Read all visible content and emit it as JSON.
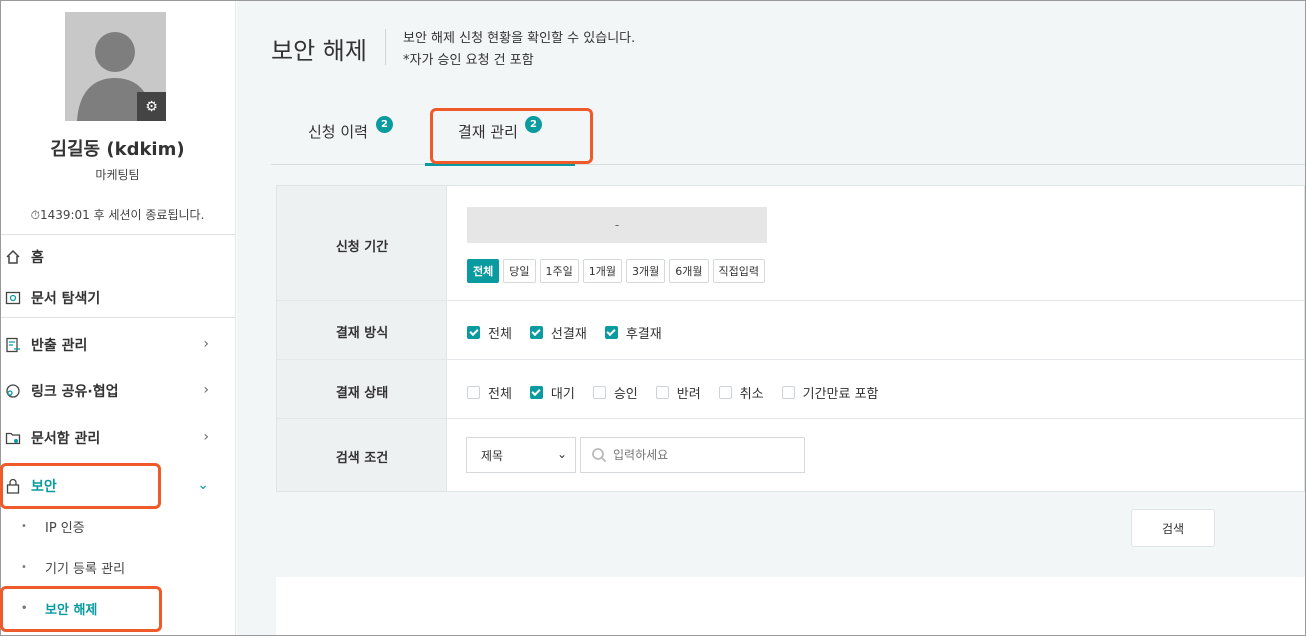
{
  "sidebar": {
    "user_name": "김길동 (kdkim)",
    "team": "마케팅팀",
    "session": "1439:01 후 세션이 종료됩니다.",
    "menu": {
      "home": "홈",
      "doc_explorer": "문서 탐색기",
      "export": "반출 관리",
      "link_share": "링크 공유·협업",
      "doc_box": "문서함 관리",
      "security": "보안"
    },
    "sub_menu": {
      "ip_auth": "IP 인증",
      "device": "기기 등록 관리",
      "unlock": "보안 해제"
    }
  },
  "header": {
    "title": "보안 해제",
    "desc_line1": "보안 해제 신청 현황을 확인할 수 있습니다.",
    "desc_line2": "*자가 승인 요청 건 포함"
  },
  "tabs": {
    "history": "신청 이력",
    "history_count": "2",
    "approval": "결재 관리",
    "approval_count": "2"
  },
  "filter": {
    "period_label": "신청 기간",
    "date_range": "-",
    "period_buttons": [
      "전체",
      "당일",
      "1주일",
      "1개월",
      "3개월",
      "6개월",
      "직접입력"
    ],
    "method_label": "결재 방식",
    "method_options": [
      "전체",
      "선결재",
      "후결재"
    ],
    "status_label": "결재 상태",
    "status_options": [
      "전체",
      "대기",
      "승인",
      "반려",
      "취소",
      "기간만료 포함"
    ],
    "condition_label": "검색 조건",
    "condition_selected": "제목",
    "search_placeholder": "입력하세요"
  },
  "search_button": "검색",
  "colors": {
    "accent": "#0a9ba0",
    "callout": "#ef5a2a"
  }
}
